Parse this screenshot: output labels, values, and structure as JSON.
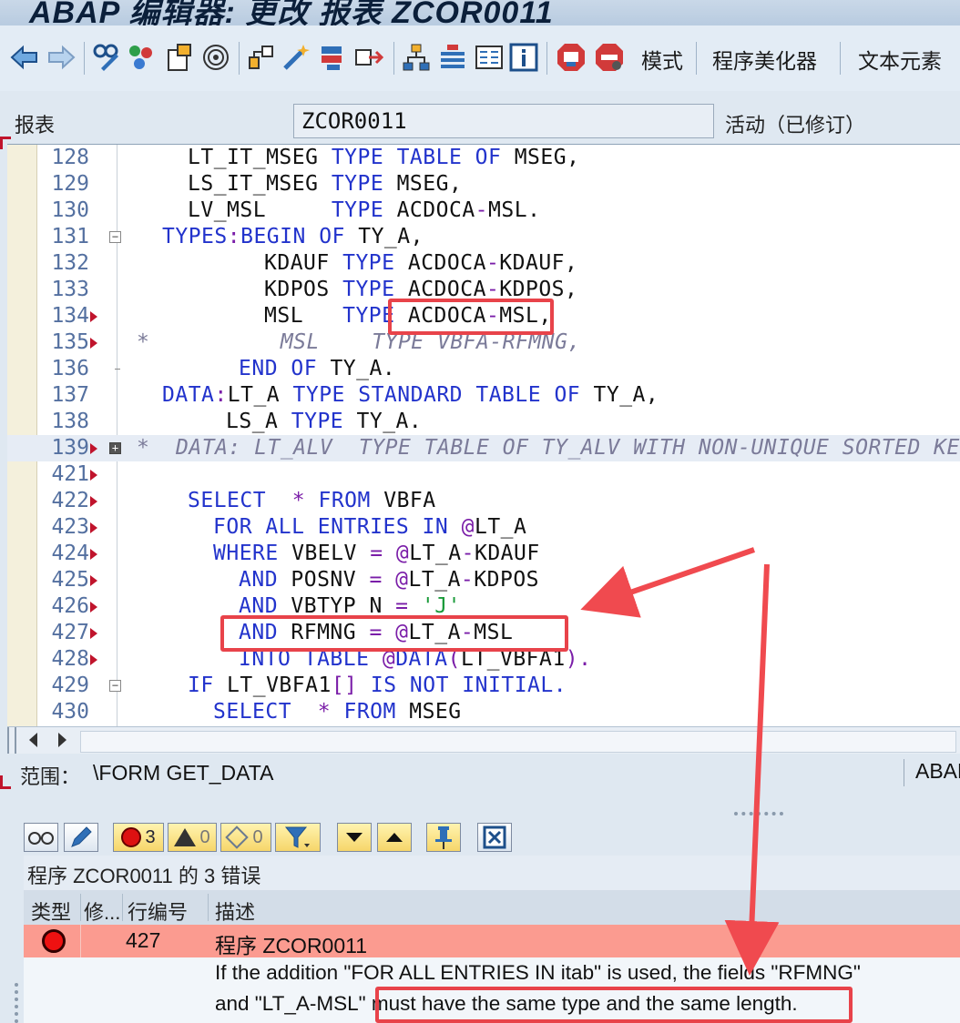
{
  "window": {
    "title": "ABAP 编辑器: 更改 报表 ZCOR0011"
  },
  "toolbar": {
    "icons": [
      "back-icon",
      "forward-icon",
      "toggle-display-change-icon",
      "activate-check-icon",
      "other-object-icon",
      "where-used-icon",
      "display-object-list-icon",
      "enhancement-icon",
      "stack-icon",
      "navigation-window-icon",
      "object-hierarchy-icon",
      "pattern-icon",
      "pretty-print-icon",
      "info-icon",
      "breakpoint-icon",
      "external-breakpoint-icon"
    ],
    "mode_label": "模式",
    "pretty_printer_label": "程序美化器",
    "text_elements_label": "文本元素"
  },
  "header": {
    "report_label": "报表",
    "report_name": "ZCOR0011",
    "status": "活动（已修订）"
  },
  "editor": {
    "lines": [
      {
        "num": "128",
        "arrow": false,
        "fold": "",
        "indent": 7,
        "tokens": [
          [
            "n",
            "LT_IT_MSEG "
          ],
          [
            "k",
            "TYPE TABLE OF "
          ],
          [
            "n",
            "MSEG,"
          ]
        ]
      },
      {
        "num": "129",
        "arrow": false,
        "fold": "",
        "indent": 7,
        "tokens": [
          [
            "n",
            "LS_IT_MSEG "
          ],
          [
            "k",
            "TYPE "
          ],
          [
            "n",
            "MSEG,"
          ]
        ]
      },
      {
        "num": "130",
        "arrow": false,
        "fold": "",
        "indent": 7,
        "tokens": [
          [
            "n",
            "LV_MSL     "
          ],
          [
            "k",
            "TYPE "
          ],
          [
            "n",
            "ACDOCA"
          ],
          [
            "o",
            "-"
          ],
          [
            "n",
            "MSL."
          ]
        ]
      },
      {
        "num": "131",
        "arrow": false,
        "fold": "minus",
        "indent": 5,
        "tokens": [
          [
            "k",
            "TYPES"
          ],
          [
            "o",
            ":"
          ],
          [
            "k",
            "BEGIN OF "
          ],
          [
            "n",
            "TY_A,"
          ]
        ]
      },
      {
        "num": "132",
        "arrow": false,
        "fold": "",
        "indent": 13,
        "tokens": [
          [
            "n",
            "KDAUF "
          ],
          [
            "k",
            "TYPE "
          ],
          [
            "n",
            "ACDOCA"
          ],
          [
            "o",
            "-"
          ],
          [
            "n",
            "KDAUF,"
          ]
        ]
      },
      {
        "num": "133",
        "arrow": false,
        "fold": "",
        "indent": 13,
        "tokens": [
          [
            "n",
            "KDPOS "
          ],
          [
            "k",
            "TYPE "
          ],
          [
            "n",
            "ACDOCA"
          ],
          [
            "o",
            "-"
          ],
          [
            "n",
            "KDPOS,"
          ]
        ]
      },
      {
        "num": "134",
        "arrow": true,
        "fold": "",
        "indent": 13,
        "tokens": [
          [
            "n",
            "MSL   "
          ],
          [
            "k",
            "TYPE "
          ],
          [
            "n",
            "ACDOCA"
          ],
          [
            "o",
            "-"
          ],
          [
            "n",
            "MSL,"
          ]
        ]
      },
      {
        "num": "135",
        "arrow": true,
        "fold": "",
        "indent": 3,
        "tokens": [
          [
            "c",
            "*          MSL    TYPE VBFA-RFMNG,"
          ]
        ]
      },
      {
        "num": "136",
        "arrow": false,
        "fold": "end",
        "indent": 11,
        "tokens": [
          [
            "k",
            "END OF "
          ],
          [
            "n",
            "TY_A."
          ]
        ]
      },
      {
        "num": "137",
        "arrow": false,
        "fold": "",
        "indent": 5,
        "tokens": [
          [
            "k",
            "DATA"
          ],
          [
            "o",
            ":"
          ],
          [
            "n",
            "LT_A "
          ],
          [
            "k",
            "TYPE STANDARD TABLE OF "
          ],
          [
            "n",
            "TY_A,"
          ]
        ]
      },
      {
        "num": "138",
        "arrow": false,
        "fold": "",
        "indent": 10,
        "tokens": [
          [
            "n",
            "LS_A "
          ],
          [
            "k",
            "TYPE "
          ],
          [
            "n",
            "TY_A."
          ]
        ]
      },
      {
        "num": "139",
        "arrow": true,
        "fold": "plus",
        "indent": 3,
        "hl": true,
        "tokens": [
          [
            "c",
            "*  DATA: LT_ALV  TYPE TABLE OF TY_ALV WITH NON-UNIQUE SORTED KEY"
          ]
        ]
      },
      {
        "num": "421",
        "arrow": true,
        "fold": "",
        "indent": 0,
        "tokens": []
      },
      {
        "num": "422",
        "arrow": true,
        "fold": "",
        "indent": 7,
        "tokens": [
          [
            "k",
            "SELECT  "
          ],
          [
            "o",
            "* "
          ],
          [
            "k",
            "FROM "
          ],
          [
            "n",
            "VBFA"
          ]
        ]
      },
      {
        "num": "423",
        "arrow": true,
        "fold": "",
        "indent": 9,
        "tokens": [
          [
            "k",
            "FOR ALL ENTRIES IN "
          ],
          [
            "o",
            "@"
          ],
          [
            "n",
            "LT_A"
          ]
        ]
      },
      {
        "num": "424",
        "arrow": true,
        "fold": "",
        "indent": 9,
        "tokens": [
          [
            "k",
            "WHERE "
          ],
          [
            "n",
            "VBELV "
          ],
          [
            "o",
            "= @"
          ],
          [
            "n",
            "LT_A"
          ],
          [
            "o",
            "-"
          ],
          [
            "n",
            "KDAUF"
          ]
        ]
      },
      {
        "num": "425",
        "arrow": true,
        "fold": "",
        "indent": 11,
        "tokens": [
          [
            "k",
            "AND "
          ],
          [
            "n",
            "POSNV "
          ],
          [
            "o",
            "= @"
          ],
          [
            "n",
            "LT_A"
          ],
          [
            "o",
            "-"
          ],
          [
            "n",
            "KDPOS"
          ]
        ]
      },
      {
        "num": "426",
        "arrow": true,
        "fold": "",
        "indent": 11,
        "tokens": [
          [
            "k",
            "AND "
          ],
          [
            "n",
            "VBTYP_N "
          ],
          [
            "o",
            "= "
          ],
          [
            "s",
            "'J'"
          ]
        ]
      },
      {
        "num": "427",
        "arrow": true,
        "fold": "",
        "indent": 11,
        "tokens": [
          [
            "k",
            "AND "
          ],
          [
            "n",
            "RFMNG "
          ],
          [
            "o",
            "= @"
          ],
          [
            "n",
            "LT_A"
          ],
          [
            "o",
            "-"
          ],
          [
            "n",
            "MSL"
          ]
        ]
      },
      {
        "num": "428",
        "arrow": true,
        "fold": "",
        "indent": 11,
        "tokens": [
          [
            "k",
            "INTO TABLE "
          ],
          [
            "o",
            "@"
          ],
          [
            "k",
            "DATA"
          ],
          [
            "o",
            "("
          ],
          [
            "n",
            "LT_VBFA1"
          ],
          [
            "o",
            ")."
          ]
        ]
      },
      {
        "num": "429",
        "arrow": false,
        "fold": "minus",
        "indent": 7,
        "tokens": [
          [
            "k",
            "IF "
          ],
          [
            "n",
            "LT_VBFA1"
          ],
          [
            "o",
            "[] "
          ],
          [
            "k",
            "IS NOT INITIAL."
          ]
        ]
      },
      {
        "num": "430",
        "arrow": false,
        "fold": "",
        "indent": 9,
        "tokens": [
          [
            "k",
            "SELECT  "
          ],
          [
            "o",
            "* "
          ],
          [
            "k",
            "FROM "
          ],
          [
            "n",
            "MSEG"
          ]
        ]
      }
    ]
  },
  "scope": {
    "label": "范围：",
    "value": "\\FORM GET_DATA",
    "tag": "ABAP"
  },
  "errors": {
    "toolbar": {
      "error_count": "3",
      "warning_count": "0",
      "info_count": "0"
    },
    "title": "程序 ZCOR0011 的 3 错误",
    "columns": [
      "类型",
      "修...",
      "行编号",
      "描述"
    ],
    "row": {
      "line": "427",
      "program": "程序 ZCOR0011",
      "message_line1": "If the addition \"FOR ALL ENTRIES IN itab\" is used, the fields \"RFMNG\"",
      "message_line2": "and \"LT_A-MSL\" must have the same type and the same length."
    }
  },
  "colors": {
    "annotation_red": "#e8434a",
    "keyword_blue": "#2233cc",
    "operator_purple": "#7a1da8",
    "string_green": "#1a9a3a",
    "error_row": "#fb9b90"
  }
}
